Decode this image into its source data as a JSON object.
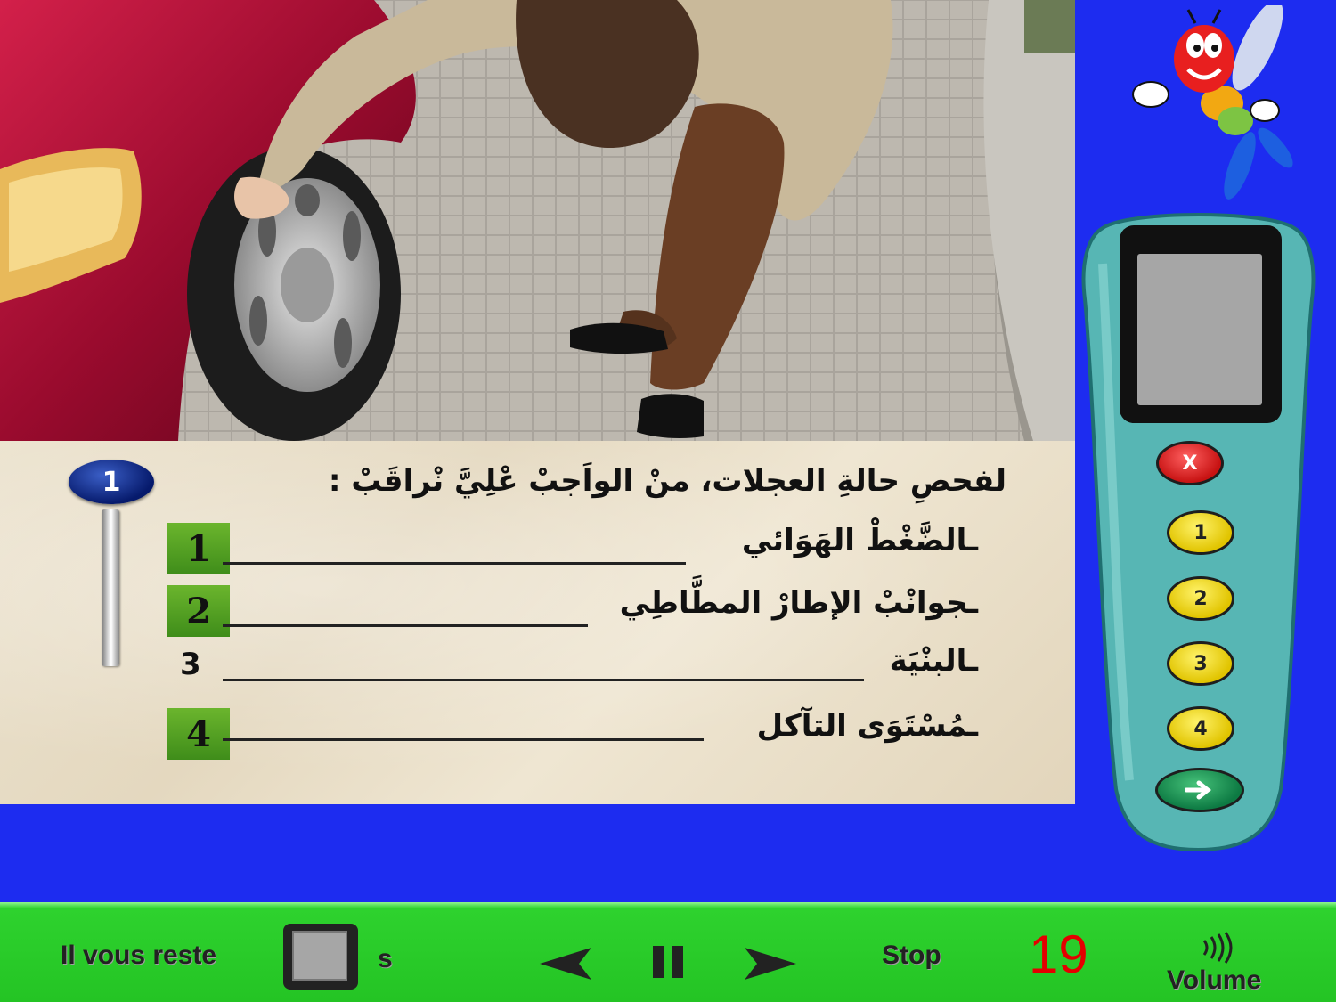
{
  "question": {
    "number": "1",
    "text": "لفحصِ حالةِ العجلات، منْ الواَجبْ عْلِيَّ نْراقَبْ :",
    "answers": [
      {
        "key": "1",
        "text": "ـالضَّغْطْ الهَوَائي",
        "selected": true
      },
      {
        "key": "2",
        "text": "ـجوانْبْ الإطارْ المطَّاطِي",
        "selected": true
      },
      {
        "key": "3",
        "text": "ـالبنْيَة",
        "selected": false
      },
      {
        "key": "4",
        "text": "ـمُسْتَوَى التآكل",
        "selected": true
      }
    ]
  },
  "remote": {
    "cancel_label": "X",
    "buttons": [
      "1",
      "2",
      "3",
      "4"
    ],
    "next_icon": "arrow-right-icon"
  },
  "bottom_bar": {
    "remaining_label": "Il vous reste",
    "seconds_unit": "s",
    "stop_label": "Stop",
    "counter": "19",
    "volume_label": "Volume"
  },
  "colors": {
    "background": "#1d2cf0",
    "bottom_bar": "#24c424",
    "answer_box": "#4c9d20",
    "counter": "#e40000"
  }
}
